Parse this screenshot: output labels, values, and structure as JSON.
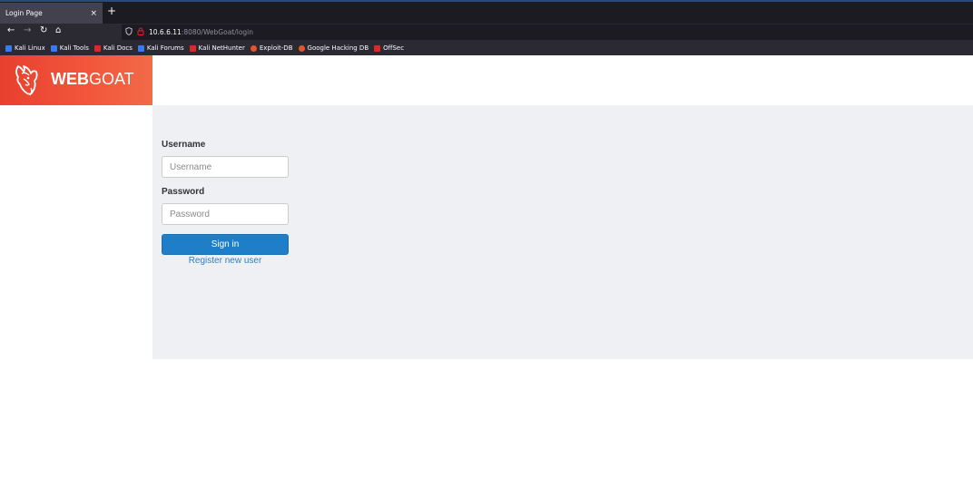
{
  "browser": {
    "tab_title": "Login Page",
    "tab_close": "×",
    "new_tab": "+",
    "back": "←",
    "forward": "→",
    "reload": "↻",
    "home": "⌂",
    "url_host": "10.6.6.11",
    "url_path": ":8080/WebGoat/login"
  },
  "bookmarks": [
    {
      "label": "Kali Linux",
      "color": "#367bf0"
    },
    {
      "label": "Kali Tools",
      "color": "#367bf0"
    },
    {
      "label": "Kali Docs",
      "color": "#e0262a"
    },
    {
      "label": "Kali Forums",
      "color": "#367bf0"
    },
    {
      "label": "Kali NetHunter",
      "color": "#e0262a"
    },
    {
      "label": "Exploit-DB",
      "color": "#e8532c"
    },
    {
      "label": "Google Hacking DB",
      "color": "#e8532c"
    },
    {
      "label": "OffSec",
      "color": "#e0262a"
    }
  ],
  "logo": {
    "web": "WEB",
    "goat": "GOAT",
    "bg_color": "#ef4b34"
  },
  "login": {
    "username_label": "Username",
    "username_placeholder": "Username",
    "password_label": "Password",
    "password_placeholder": "Password",
    "signin_label": "Sign in",
    "register_label": "Register new user",
    "button_color": "#1e7fc8",
    "link_color": "#2a7fc2"
  }
}
